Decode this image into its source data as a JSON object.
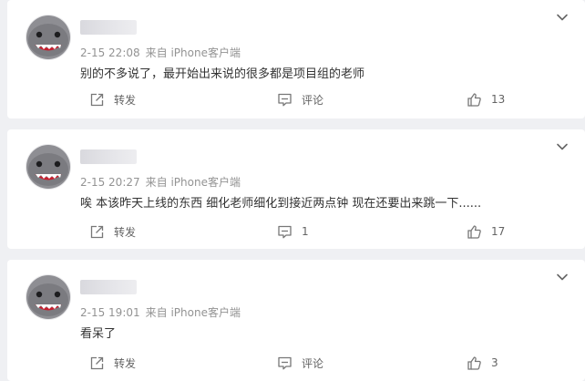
{
  "comments": [
    {
      "time": "2-15 22:08",
      "source": "来自 iPhone客户端",
      "text": "别的不多说了，最开始出来说的很多都是项目组的老师",
      "repost_label": "转发",
      "comment_label": "评论",
      "like_count": "13"
    },
    {
      "time": "2-15 20:27",
      "source": "来自 iPhone客户端",
      "text": "唉 本该昨天上线的东西 细化老师细化到接近两点钟 现在还要出来跳一下......",
      "repost_label": "转发",
      "comment_label": "1",
      "like_count": "17"
    },
    {
      "time": "2-15 19:01",
      "source": "来自 iPhone客户端",
      "text": "看呆了",
      "repost_label": "转发",
      "comment_label": "评论",
      "like_count": "3"
    }
  ],
  "icons": {
    "avatar": "shark-avatar",
    "menu": "chevron-down-icon",
    "repost": "repost-icon",
    "comment": "comment-icon",
    "like": "thumbs-up-icon"
  },
  "colors": {
    "background": "#eff0f3",
    "card": "#ffffff",
    "text": "#333333",
    "meta": "#939393",
    "action": "#636363"
  }
}
